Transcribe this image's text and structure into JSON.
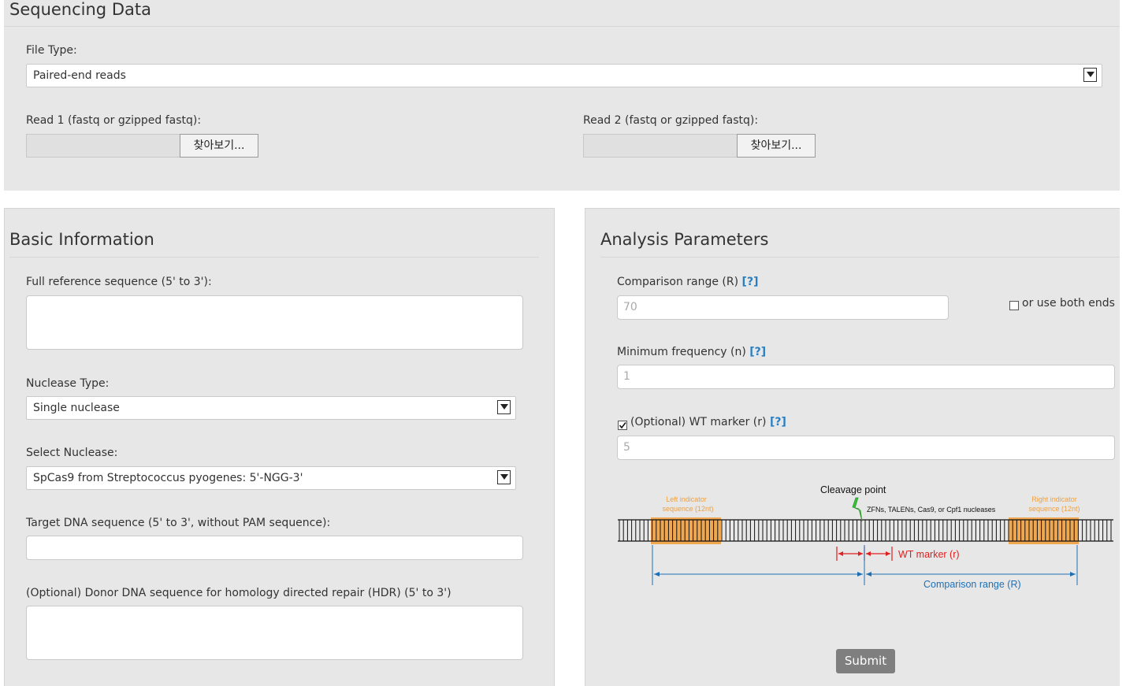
{
  "sequencing": {
    "title": "Sequencing Data",
    "file_type_label": "File Type:",
    "file_type_value": "Paired-end reads",
    "read1_label": "Read 1 (fastq or gzipped fastq):",
    "read2_label": "Read 2 (fastq or gzipped fastq):",
    "browse_label": "찾아보기..."
  },
  "basic": {
    "title": "Basic Information",
    "reference_label": "Full reference sequence (5' to 3'):",
    "nuclease_type_label": "Nuclease Type:",
    "nuclease_type_value": "Single nuclease",
    "select_nuclease_label": "Select Nuclease:",
    "select_nuclease_value": "SpCas9 from Streptococcus pyogenes: 5'-NGG-3'",
    "target_label": "Target DNA sequence (5' to 3', without PAM sequence):",
    "donor_label": "(Optional) Donor DNA sequence for homology directed repair (HDR) (5' to 3')"
  },
  "analysis": {
    "title": "Analysis Parameters",
    "comparison_label": "Comparison range (R)",
    "comparison_placeholder": "70",
    "both_ends_label": "or use both ends",
    "min_freq_label": "Minimum frequency (n)",
    "min_freq_placeholder": "1",
    "wt_marker_label": "(Optional) WT marker (r)",
    "wt_marker_placeholder": "5",
    "wt_marker_checked": true,
    "help_marker": "[?]",
    "submit_label": "Submit"
  },
  "diagram": {
    "cleavage_point": "Cleavage point",
    "nucleases": "ZFNs, TALENs, Cas9, or Cpf1 nucleases",
    "left_indicator_1": "Left indicator",
    "left_indicator_2": "sequence (12nt)",
    "right_indicator_1": "Right indicator",
    "right_indicator_2": "sequence (12nt)",
    "wt_marker": "WT marker (r)",
    "comparison_range": "Comparison range (R)",
    "colors": {
      "indicator": "#f0a040",
      "marker": "#e02020",
      "range": "#1f6fb5",
      "bolt": "#3bbf3b"
    }
  }
}
